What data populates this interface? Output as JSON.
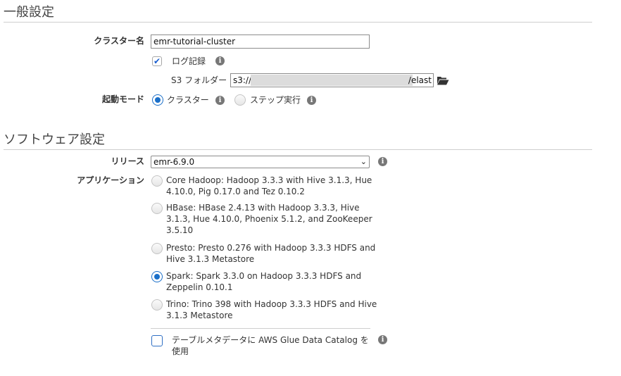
{
  "general": {
    "title": "一般設定",
    "cluster_name_label": "クラスター名",
    "cluster_name_value": "emr-tutorial-cluster",
    "logging_label": "ログ記録",
    "logging_checked": true,
    "s3_label": "S3 フォルダー",
    "s3_prefix": "s3://",
    "s3_suffix": "/elast",
    "launch_mode_label": "起動モード",
    "launch_mode_options": [
      {
        "label": "クラスター",
        "selected": true
      },
      {
        "label": "ステップ実行",
        "selected": false
      }
    ]
  },
  "software": {
    "title": "ソフトウェア設定",
    "release_label": "リリース",
    "release_value": "emr-6.9.0",
    "applications_label": "アプリケーション",
    "applications": [
      {
        "label": "Core Hadoop: Hadoop 3.3.3 with Hive 3.1.3, Hue\n4.10.0, Pig 0.17.0 and Tez 0.10.2",
        "selected": false
      },
      {
        "label": "HBase: HBase 2.4.13 with Hadoop 3.3.3, Hive\n3.1.3, Hue 4.10.0, Phoenix 5.1.2, and ZooKeeper\n3.5.10",
        "selected": false
      },
      {
        "label": "Presto: Presto 0.276 with Hadoop 3.3.3 HDFS and\nHive 3.1.3 Metastore",
        "selected": false
      },
      {
        "label": "Spark: Spark 3.3.0 on Hadoop 3.3.3 HDFS and\nZeppelin 0.10.1",
        "selected": true
      },
      {
        "label": "Trino: Trino 398 with Hadoop 3.3.3 HDFS and Hive\n3.1.3 Metastore",
        "selected": false
      }
    ],
    "glue_label": "テーブルメタデータに AWS Glue Data Catalog を\n使用",
    "glue_checked": false
  },
  "icons": [
    "info-icon",
    "folder-open-icon",
    "chevron-down-icon",
    "check-icon"
  ]
}
